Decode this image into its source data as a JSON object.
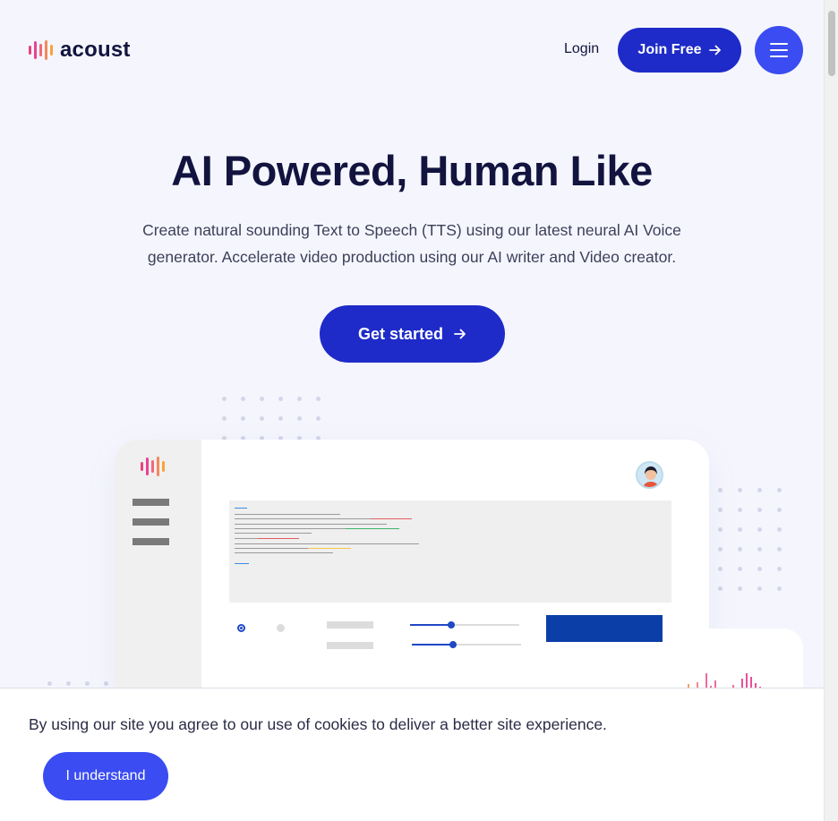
{
  "brand": {
    "name": "acoust",
    "logo_colors": [
      "#e84393",
      "#e84393",
      "#f06a7a",
      "#f5895b",
      "#f7a23f"
    ]
  },
  "header": {
    "login_label": "Login",
    "join_label": "Join Free",
    "menu_icon": "hamburger-icon"
  },
  "hero": {
    "title": "AI Powered, Human Like",
    "subtitle": "Create natural sounding Text to Speech (TTS) using our latest neural AI Voice generator. Accelerate video production using our AI writer and Video creator.",
    "cta_label": "Get started",
    "cta_icon": "arrow-right-icon"
  },
  "cookie_banner": {
    "message": "By using our site you agree to our use of cookies to deliver a better site experience.",
    "button_label": "I understand"
  },
  "colors": {
    "primary": "#1e2bc8",
    "accent": "#3a4cf2",
    "text": "#12143f",
    "background": "#f5f6fd"
  }
}
